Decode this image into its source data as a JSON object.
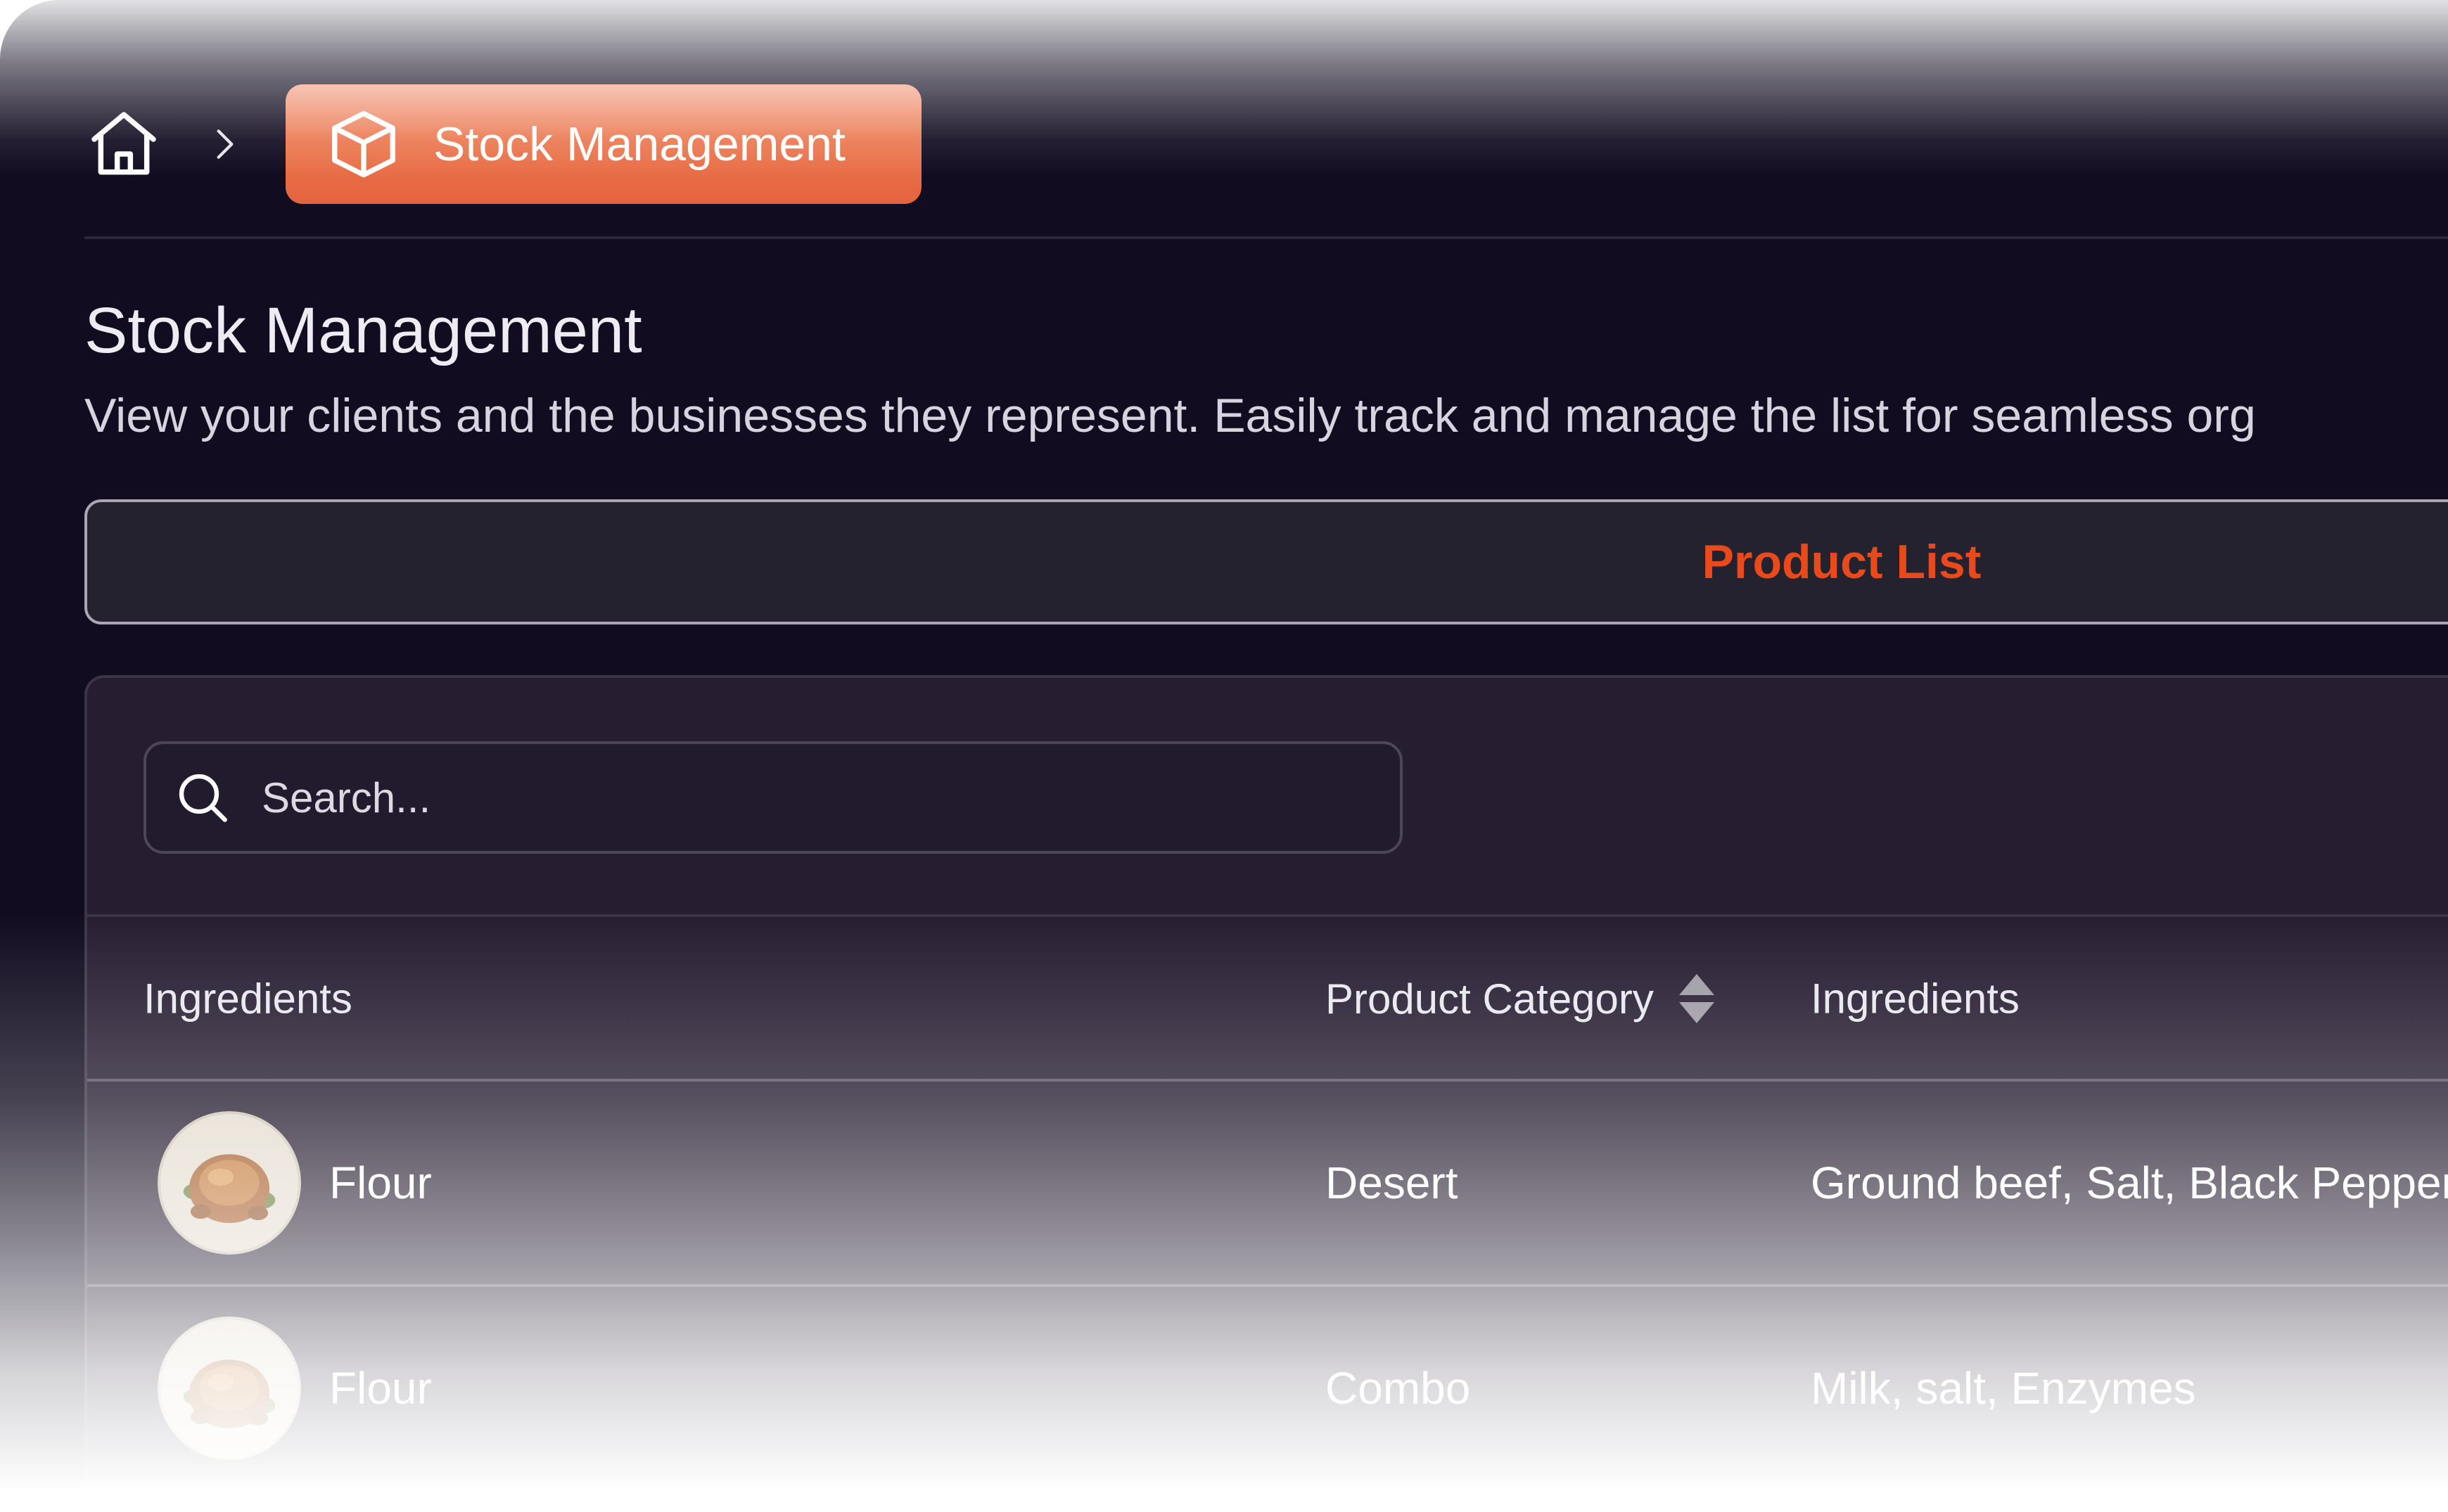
{
  "breadcrumb": {
    "home_icon": "home-icon",
    "separator_icon": "chevron-right-icon",
    "current": {
      "icon": "package-icon",
      "label": "Stock Management"
    }
  },
  "page": {
    "title": "Stock Management",
    "subtitle": "View your clients and the businesses they represent. Easily track and manage the list for seamless org"
  },
  "tabs": [
    {
      "label": "Product List",
      "active": true
    }
  ],
  "search": {
    "placeholder": "Search...",
    "value": ""
  },
  "table": {
    "columns": [
      "Ingredients",
      "Product Category",
      "Ingredients"
    ],
    "rows": [
      {
        "name": "Flour",
        "category": "Desert",
        "ingredients": "Ground beef, Salt, Black Pepper"
      },
      {
        "name": "Flour",
        "category": "Combo",
        "ingredients": "Milk, salt, Enzymes"
      }
    ]
  },
  "colors": {
    "background": "#110c20",
    "accent": "#ea4a1b",
    "breadcrumb_active": "#e8714a",
    "panel": "#261d31"
  }
}
